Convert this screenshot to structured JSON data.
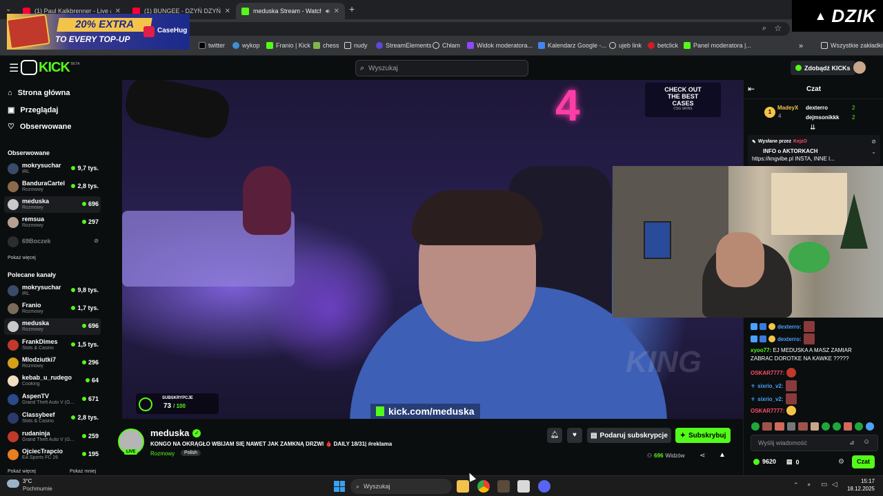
{
  "browser": {
    "tabs": [
      {
        "title": "(1) Paul Kalkbrenner - Live at Tc",
        "active": false,
        "favicon_color": "#ff0033"
      },
      {
        "title": "(1) BUNGEE - DZYŃ DZYŃ DZ",
        "active": false,
        "favicon_color": "#ff0033"
      },
      {
        "title": "meduska Stream - Watch Li",
        "active": true,
        "favicon_color": "#53fc18"
      }
    ],
    "new_tab": "+",
    "bookmarks": [
      {
        "label": "twitter",
        "icon": "x-icon",
        "color": "#ffffff"
      },
      {
        "label": "wykop",
        "icon": "wykop-icon",
        "color": "#3b8fd8"
      },
      {
        "label": "Franio | Kick",
        "icon": "kick-icon",
        "color": "#53fc18"
      },
      {
        "label": "chess",
        "icon": "pawn-icon",
        "color": "#81b64c"
      },
      {
        "label": "nudy",
        "icon": "folder-icon",
        "color": "#dcdcdc"
      },
      {
        "label": "StreamElements",
        "icon": "streamelements-icon",
        "color": "#5d48d8"
      },
      {
        "label": "Chłam",
        "icon": "globe-icon",
        "color": "#dcdcdc"
      },
      {
        "label": "Widok moderatora...",
        "icon": "twitch-icon",
        "color": "#9146ff"
      },
      {
        "label": "Kalendarz Google -...",
        "icon": "calendar-icon",
        "color": "#4285f4"
      },
      {
        "label": "ujeb link",
        "icon": "globe-icon",
        "color": "#dcdcdc"
      },
      {
        "label": "betclick",
        "icon": "betclick-icon",
        "color": "#d11e26"
      },
      {
        "label": "Panel moderatora |...",
        "icon": "kick-icon",
        "color": "#53fc18"
      }
    ],
    "all_bookmarks": "Wszystkie zakładki",
    "more_bookmarks": "»"
  },
  "ad": {
    "headline": "20% EXTRA",
    "subline": "TO EVERY TOP-UP",
    "brand": "CaseHug"
  },
  "dzik_logo": "DZIK",
  "kick": {
    "search_placeholder": "Wyszukaj",
    "kicks_button": "Zdobądź KICKs",
    "logo_text": "KICK",
    "logo_tag": "BETA"
  },
  "sidebar": {
    "nav": [
      {
        "label": "Strona główna",
        "icon": "home-icon"
      },
      {
        "label": "Przeglądaj",
        "icon": "browse-icon"
      },
      {
        "label": "Obserwowane",
        "icon": "heart-icon"
      }
    ],
    "followed_title": "Obserwowane",
    "followed": [
      {
        "name": "mokrysuchar",
        "category": "IRL",
        "viewers": "9,7 tys.",
        "live": true,
        "color": "#3a4a6a",
        "selected": false
      },
      {
        "name": "BanduraCartel",
        "category": "Rozmowy",
        "viewers": "2,8 tys.",
        "live": true,
        "color": "#8a6a4a",
        "selected": false
      },
      {
        "name": "meduska",
        "category": "Rozmowy",
        "viewers": "696",
        "live": true,
        "color": "#c9c9c9",
        "selected": true
      },
      {
        "name": "remsua",
        "category": "Rozmowy",
        "viewers": "297",
        "live": true,
        "color": "#b8a090",
        "selected": false
      },
      {
        "name": "69Boczek",
        "category": "",
        "viewers": "",
        "live": false,
        "color": "#555555",
        "selected": false
      }
    ],
    "show_more_1": "Pokaż więcej",
    "recommended_title": "Polecane kanały",
    "recommended": [
      {
        "name": "mokrysuchar",
        "category": "IRL",
        "viewers": "9,8 tys.",
        "color": "#3a4a6a",
        "selected": false
      },
      {
        "name": "Franio",
        "category": "Rozmowy",
        "viewers": "1,7 tys.",
        "color": "#7a6a5a",
        "selected": false
      },
      {
        "name": "meduska",
        "category": "Rozmowy",
        "viewers": "696",
        "color": "#c9c9c9",
        "selected": true
      },
      {
        "name": "FrankDimes",
        "category": "Slots & Casino",
        "viewers": "1,5 tys.",
        "color": "#c0392b",
        "selected": false
      },
      {
        "name": "Mlodziutki7",
        "category": "Rozmowy",
        "viewers": "296",
        "color": "#d4a017",
        "selected": false
      },
      {
        "name": "kebab_u_rudego",
        "category": "Cooking",
        "viewers": "64",
        "color": "#f0e0c0",
        "selected": false
      },
      {
        "name": "AspenTV",
        "category": "Grand Theft Auto V (G...",
        "viewers": "671",
        "color": "#2a4a8a",
        "selected": false
      },
      {
        "name": "Classybeef",
        "category": "Slots & Casino",
        "viewers": "2,8 tys.",
        "color": "#2a3a6a",
        "selected": false
      },
      {
        "name": "rudaninja",
        "category": "Grand Theft Auto V (G...",
        "viewers": "259",
        "color": "#c0392b",
        "selected": false
      },
      {
        "name": "OjciecTrapcio",
        "category": "EA Sports FC 26",
        "viewers": "195",
        "color": "#e67e22",
        "selected": false
      }
    ],
    "show_more_2": "Pokaż więcej",
    "show_less": "Pokaż mniej"
  },
  "video": {
    "sub_label": "SUBSKRYPCJE",
    "sub_progress": "73",
    "sub_total": "/ 100",
    "sub_progress_fraction": 0.73,
    "url_overlay": "kick.com/meduska",
    "promo_line1": "CHECK OUT",
    "promo_line2": "THE BEST",
    "promo_line3": "CASES",
    "promo_brand": "CSG SKINS",
    "watermark": "KING",
    "neon": "4"
  },
  "stream": {
    "streamer": "meduska",
    "live_badge": "LIVE",
    "title": "KONGO NA OKRĄGŁO WBIJAM SIĘ NAWET JAK ZAMKNĄ DRZWI 🩸 DAILY 18/31| #reklama",
    "category": "Rozmowy",
    "tag": "Polish",
    "gift_button": "Podaruj subskrypcje",
    "subscribe_button": "Subskrybuj",
    "viewers": "696",
    "viewers_label": "Widzów"
  },
  "chat": {
    "title": "Czat",
    "top_gifters": [
      {
        "name": "MadeyX",
        "count": "4"
      },
      {
        "name": "dexterro",
        "count": "2"
      },
      {
        "name": "dejmsonikkk",
        "count": "2"
      }
    ],
    "pinned_by_label": "Wysłane przez",
    "pinned_by": "KejzO",
    "pinned_title": "INFO o AKTORKACH",
    "pinned_text": "https://kngvibe.pl INSTA, INNE I...",
    "messages": [
      {
        "user": "dexterro:",
        "text": "",
        "color": "#4aa3ff"
      },
      {
        "user": "dexterro:",
        "text": "",
        "color": "#4aa3ff"
      },
      {
        "user": "xyoo77:",
        "text": "EJ MEDUSKA A MASZ ZAMIAR ZABRAC DOROTKE NA KAWKE ?????",
        "color": "#53fc18"
      },
      {
        "user": "OSKAR7777:",
        "text": "",
        "color": "#ff4d6d"
      },
      {
        "user": "sixrio_v2:",
        "text": "",
        "color": "#4aa3ff"
      },
      {
        "user": "sixrio_v2:",
        "text": "",
        "color": "#4aa3ff"
      },
      {
        "user": "OSKAR7777:",
        "text": "",
        "color": "#ff4d6d"
      }
    ],
    "input_placeholder": "Wyślij wiadomość",
    "kicks_count": "9620",
    "gift_count": "0",
    "send_button": "Czat"
  },
  "taskbar": {
    "weather_temp": "3°C",
    "weather_text": "Pochmurnie",
    "search_placeholder": "Wyszukaj",
    "time": "15:17",
    "date": "18.12.2025"
  }
}
